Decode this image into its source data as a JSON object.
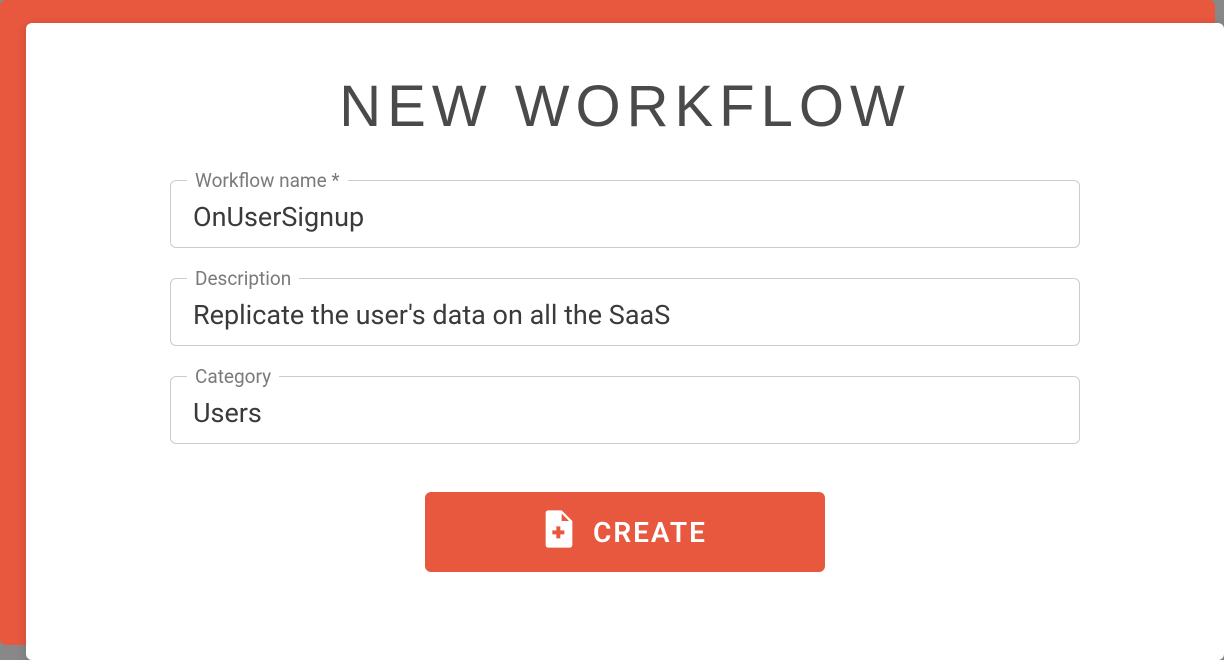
{
  "modal": {
    "title": "NEW WORKFLOW",
    "fields": {
      "name": {
        "label": "Workflow name *",
        "value": "OnUserSignup"
      },
      "description": {
        "label": "Description",
        "value": "Replicate the user's data on all the SaaS"
      },
      "category": {
        "label": "Category",
        "value": "Users"
      }
    },
    "create_button": "CREATE"
  },
  "colors": {
    "accent": "#e8583f"
  }
}
